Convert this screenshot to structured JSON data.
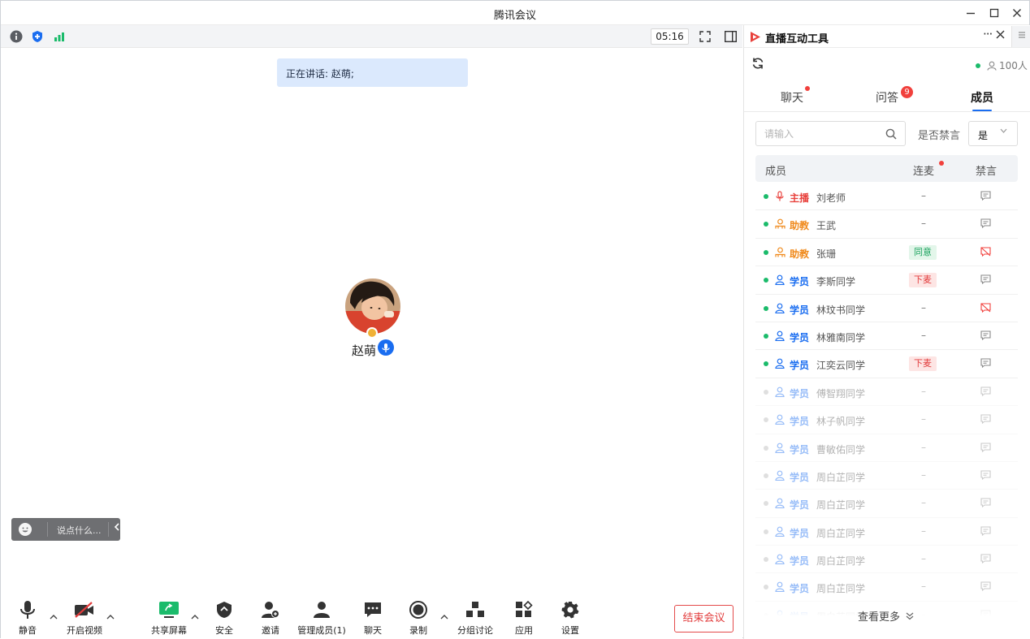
{
  "window": {
    "title": "腾讯会议"
  },
  "meeting": {
    "timer": "05:16",
    "speaking": "正在讲话: 赵萌;",
    "participant_name": "赵萌",
    "chat_placeholder": "说点什么..."
  },
  "toolbar": {
    "mute": "静音",
    "video": "开启视频",
    "share": "共享屏幕",
    "security": "安全",
    "invite": "邀请",
    "manage": "管理成员(1)",
    "chat": "聊天",
    "record": "录制",
    "breakout": "分组讨论",
    "apps": "应用",
    "settings": "设置",
    "end": "结束会议"
  },
  "panel": {
    "title": "直播互动工具",
    "online_count": "100人",
    "tabs": [
      "聊天",
      "问答",
      "成员"
    ],
    "active_tab": "成员",
    "qa_badge": "9",
    "search_placeholder": "请输入",
    "mute_filter_label": "是否禁言",
    "mute_filter_value": "是",
    "columns": {
      "member": "成员",
      "link": "连麦",
      "mute": "禁言"
    },
    "see_more": "查看更多"
  },
  "members": [
    {
      "role": "主播",
      "name": "刘老师",
      "link": "–",
      "online": true,
      "kind": "host",
      "muted": false
    },
    {
      "role": "助教",
      "name": "王武",
      "link": "–",
      "online": true,
      "kind": "assistant",
      "muted": false
    },
    {
      "role": "助教",
      "name": "张珊",
      "link": "同意",
      "online": true,
      "kind": "assistant",
      "muted": true
    },
    {
      "role": "学员",
      "name": "李斯同学",
      "link": "下麦",
      "online": true,
      "kind": "student",
      "muted": false
    },
    {
      "role": "学员",
      "name": "林玟书同学",
      "link": "–",
      "online": true,
      "kind": "student",
      "muted": true
    },
    {
      "role": "学员",
      "name": "林雅南同学",
      "link": "–",
      "online": true,
      "kind": "student",
      "muted": false
    },
    {
      "role": "学员",
      "name": "江奕云同学",
      "link": "下麦",
      "online": true,
      "kind": "student",
      "muted": false
    },
    {
      "role": "学员",
      "name": "傅智翔同学",
      "link": "–",
      "online": false,
      "kind": "student",
      "muted": false
    },
    {
      "role": "学员",
      "name": "林子帆同学",
      "link": "–",
      "online": false,
      "kind": "student",
      "muted": false
    },
    {
      "role": "学员",
      "name": "曹敏佑同学",
      "link": "–",
      "online": false,
      "kind": "student",
      "muted": false
    },
    {
      "role": "学员",
      "name": "周白芷同学",
      "link": "–",
      "online": false,
      "kind": "student",
      "muted": false
    },
    {
      "role": "学员",
      "name": "周白芷同学",
      "link": "–",
      "online": false,
      "kind": "student",
      "muted": false
    },
    {
      "role": "学员",
      "name": "周白芷同学",
      "link": "–",
      "online": false,
      "kind": "student",
      "muted": false
    },
    {
      "role": "学员",
      "name": "周白芷同学",
      "link": "–",
      "online": false,
      "kind": "student",
      "muted": false
    },
    {
      "role": "学员",
      "name": "周白芷同学",
      "link": "–",
      "online": false,
      "kind": "student",
      "muted": false
    },
    {
      "role": "学员",
      "name": "周白芷同学",
      "link": "–",
      "online": false,
      "kind": "student",
      "muted": false
    }
  ],
  "colors": {
    "accent": "#1a6df0",
    "danger": "#f1403c",
    "host": "#e8413c",
    "assistant": "#f08a1c",
    "student": "#1a6df0",
    "online": "#1bbb6b"
  }
}
